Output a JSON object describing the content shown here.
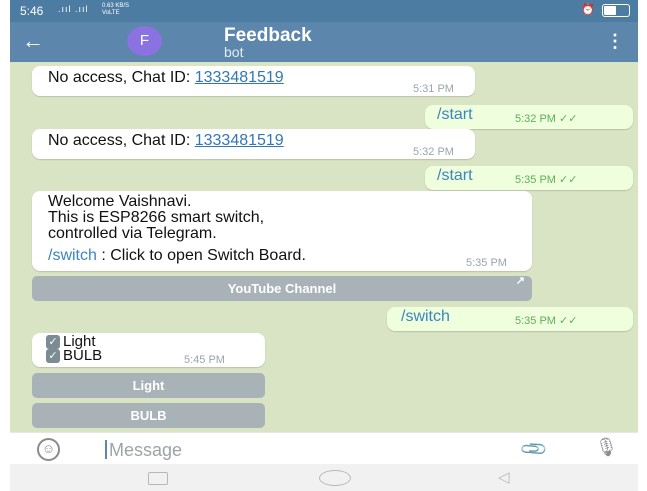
{
  "status_bar": {
    "time": "5:46",
    "signal": ".ııl .ııl",
    "network": "0.63 KB/S",
    "network_type": "VoLTE",
    "icons": [
      "alarm-icon",
      "wifi-icon"
    ],
    "battery_level": 0.52
  },
  "header": {
    "back_icon": "←",
    "avatar_letter": "F",
    "title": "Feedback",
    "subtitle": "bot",
    "menu_icon": "⋮"
  },
  "messages": [
    {
      "direction": "in",
      "text_prefix": "No access, Chat ID: ",
      "link": "1333481519",
      "time": "5:31 PM"
    },
    {
      "direction": "out",
      "text": "/start",
      "time": "5:32 PM"
    },
    {
      "direction": "in",
      "text_prefix": "No access, Chat ID: ",
      "link": "1333481519",
      "time": "5:32 PM"
    },
    {
      "direction": "out",
      "text": "/start",
      "time": "5:35 PM"
    },
    {
      "direction": "in",
      "line1": "Welcome Vaishnavi.",
      "line2": "This is ESP8266 smart switch,",
      "line3": "controlled via Telegram.",
      "command": "/switch",
      "command_desc": " : Click to open Switch Board.",
      "time": "5:35 PM"
    },
    {
      "direction": "out",
      "text": "/switch",
      "time": "5:35 PM"
    },
    {
      "direction": "in",
      "item1": "Light",
      "item2": "BULB",
      "time": "5:45 PM"
    }
  ],
  "inline_buttons": {
    "youtube": "YouTube Channel",
    "youtube_icon": "↗",
    "light": "Light",
    "bulb": "BULB"
  },
  "input": {
    "placeholder": "Message",
    "emoji_icon": "☺",
    "attach_icon": "📎",
    "mic_icon": "🎙"
  },
  "colors": {
    "header": "#5c86ac",
    "chat_bg": "#d9e4c4",
    "outgoing": "#effedd",
    "link": "#3376b4",
    "check_green": "#5fae5a"
  }
}
